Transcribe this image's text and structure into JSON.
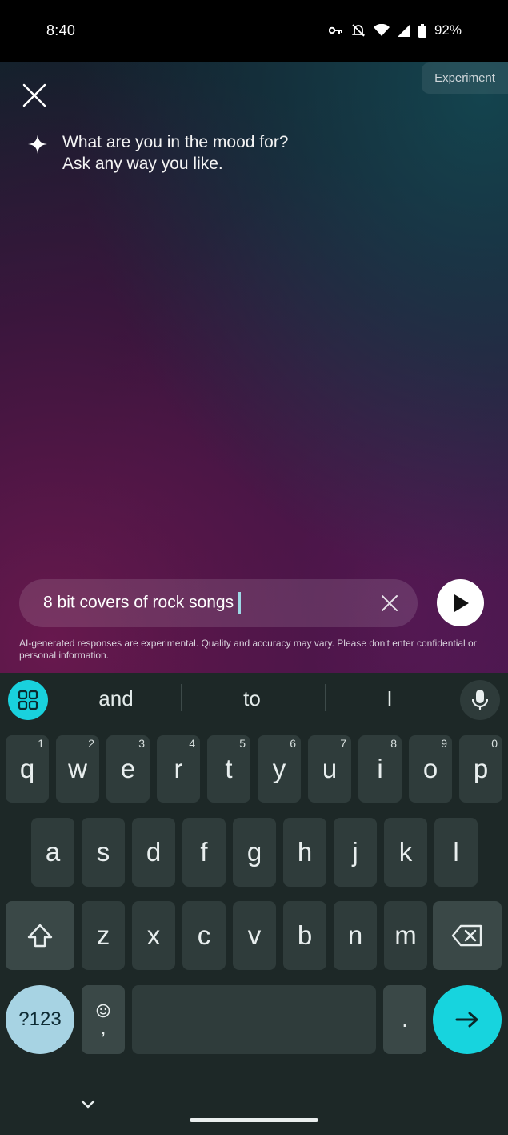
{
  "status": {
    "time": "8:40",
    "battery": "92%",
    "icons": [
      "key-icon",
      "mute-icon",
      "wifi-icon",
      "signal-icon",
      "battery-icon"
    ]
  },
  "header": {
    "experiment_label": "Experiment",
    "close_icon": "close-icon"
  },
  "prompt": {
    "line1": "What are you in the mood for?",
    "line2": "Ask any way you like."
  },
  "search": {
    "value": "8 bit covers of rock songs",
    "clear_icon": "close-icon",
    "send_icon": "play-icon"
  },
  "disclaimer": "AI-generated responses are experimental. Quality and accuracy may vary. Please don't enter confidential or personal information.",
  "keyboard": {
    "suggestions": [
      "and",
      "to",
      "I"
    ],
    "row1": [
      {
        "k": "q",
        "h": "1"
      },
      {
        "k": "w",
        "h": "2"
      },
      {
        "k": "e",
        "h": "3"
      },
      {
        "k": "r",
        "h": "4"
      },
      {
        "k": "t",
        "h": "5"
      },
      {
        "k": "y",
        "h": "6"
      },
      {
        "k": "u",
        "h": "7"
      },
      {
        "k": "i",
        "h": "8"
      },
      {
        "k": "o",
        "h": "9"
      },
      {
        "k": "p",
        "h": "0"
      }
    ],
    "row2": [
      "a",
      "s",
      "d",
      "f",
      "g",
      "h",
      "j",
      "k",
      "l"
    ],
    "row3": [
      "z",
      "x",
      "c",
      "v",
      "b",
      "n",
      "m"
    ],
    "symbols_label": "?123",
    "comma_label": ",",
    "period_label": ".",
    "accent_color": "#17d4de"
  }
}
